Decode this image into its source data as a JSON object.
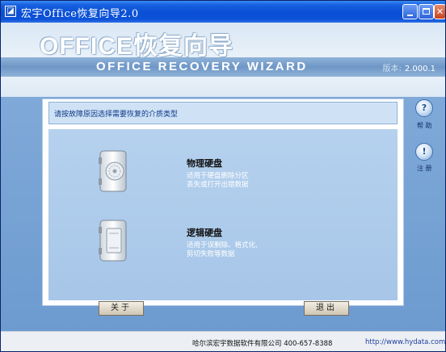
{
  "window": {
    "title": "宏宇Office恢复向导2.0",
    "controls": {
      "minimize": "minimize",
      "maximize": "maximize",
      "close": "✕"
    }
  },
  "banner": {
    "title_cn": "OFFICE恢复向导",
    "title_en": "Office Recovery Wizard",
    "version_label": "版本:",
    "version_value": "2.000.1"
  },
  "instruction": "请按故障原因选择需要恢复的介质类型",
  "options": [
    {
      "title": "物理硬盘",
      "desc_line1": "适用于硬盘删除分区",
      "desc_line2": "丢失或打开出错数据",
      "icon": "physical-disk-icon"
    },
    {
      "title": "逻辑硬盘",
      "desc_line1": "适用于误删除、格式化,",
      "desc_line2": "剪切失败等数据",
      "icon": "logical-disk-icon"
    }
  ],
  "side": {
    "help_icon": "?",
    "help_label": "帮 助",
    "register_icon": "!",
    "register_label": "注 册"
  },
  "buttons": {
    "about": "关于",
    "exit": "退出"
  },
  "footer": {
    "company": "哈尔滨宏宇数据软件有限公司  400-657-8388",
    "url": "http://www.hydata.com"
  },
  "colors": {
    "titlebar": "#0a4fd6",
    "main_bg": "#6d9bd0",
    "content_bg": "#a7c6e8",
    "instruction_bg": "#cfe2f5"
  }
}
